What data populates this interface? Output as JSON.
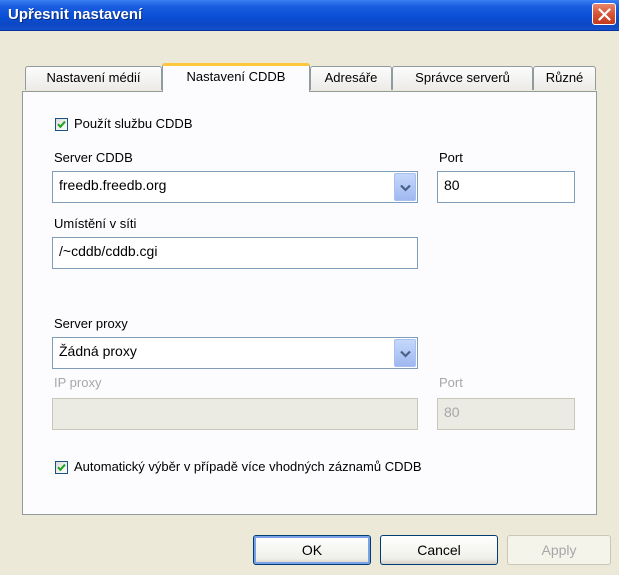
{
  "window": {
    "title": "Upřesnit nastavení",
    "close_icon": "close-icon"
  },
  "tabs": [
    {
      "label": "Nastavení médií",
      "active": false
    },
    {
      "label": "Nastavení CDDB",
      "active": true
    },
    {
      "label": "Adresáře",
      "active": false
    },
    {
      "label": "Správce serverů",
      "active": false
    },
    {
      "label": "Různé",
      "active": false
    }
  ],
  "cddb": {
    "use_cddb": {
      "label": "Použít službu CDDB",
      "checked": true
    },
    "server_label": "Server CDDB",
    "server_value": "freedb.freedb.org",
    "port_label": "Port",
    "port_value": "80",
    "location_label": "Umístění v síti",
    "location_value": "/~cddb/cddb.cgi"
  },
  "proxy": {
    "server_label": "Server proxy",
    "server_value": "Žádná proxy",
    "ip_label": "IP proxy",
    "ip_value": "",
    "port_label": "Port",
    "port_value": "80"
  },
  "auto_select": {
    "label": "Automatický výběr v případě více vhodných záznamů CDDB",
    "checked": true
  },
  "buttons": {
    "ok": "OK",
    "cancel": "Cancel",
    "apply": "Apply"
  },
  "colors": {
    "titlebar": "#0a4fd6",
    "active_tab_accent": "#ffc73c",
    "checkmark": "#21a121",
    "dialog_bg": "#ece9d8"
  }
}
